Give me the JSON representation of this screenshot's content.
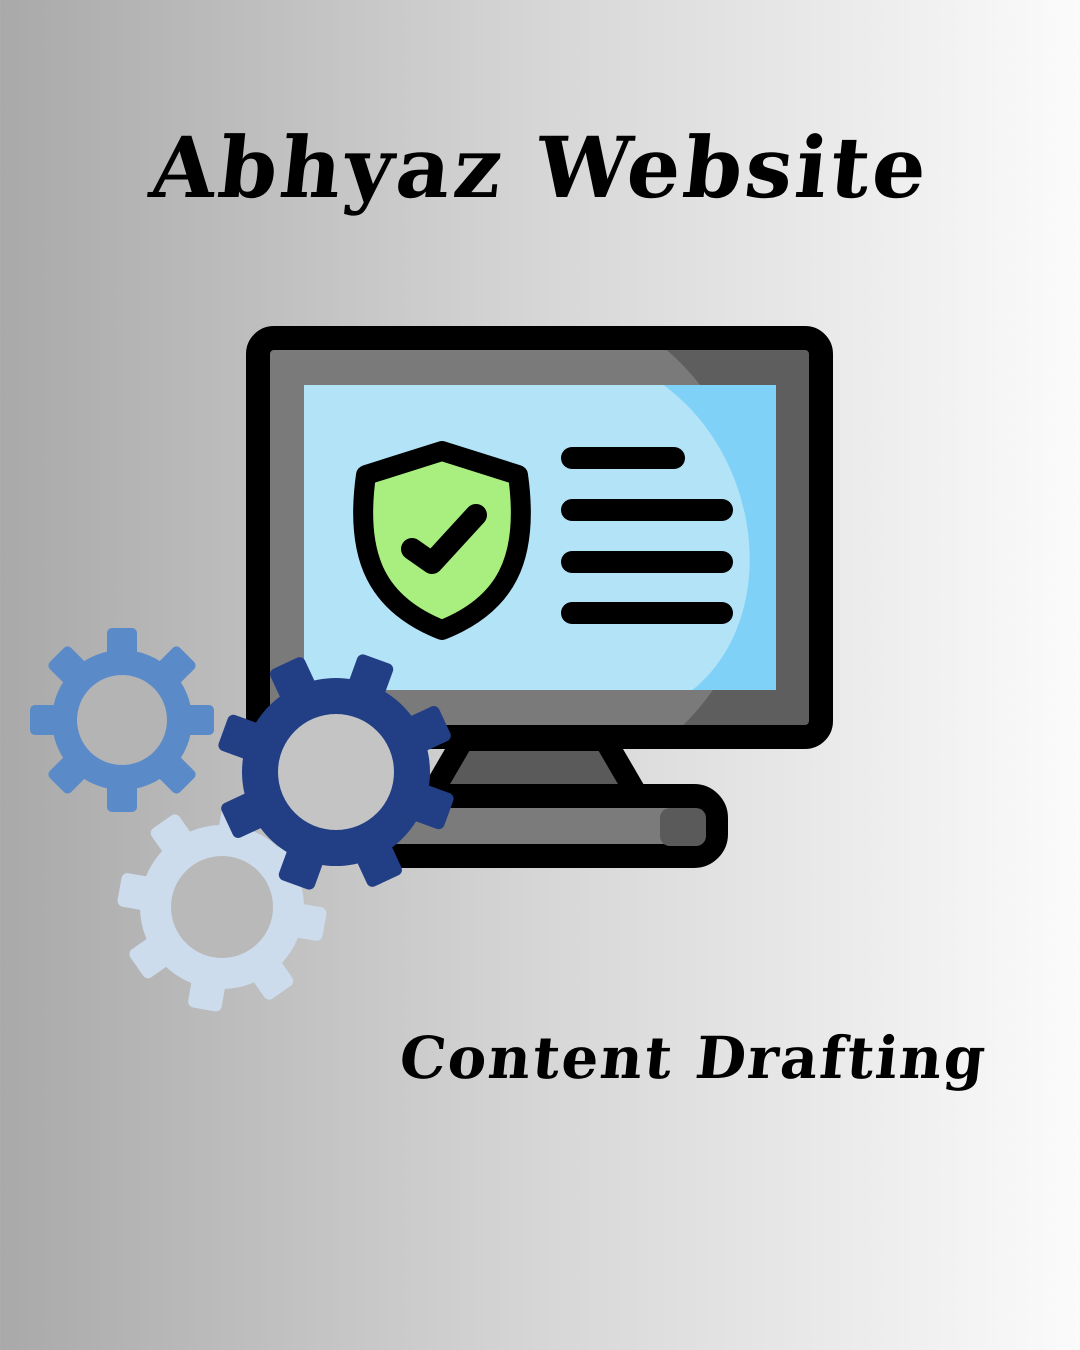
{
  "title": "Abhyaz Website",
  "subtitle": "Content Drafting",
  "icons": [
    "monitor-icon",
    "shield-check-icon",
    "gear-icon"
  ],
  "colors": {
    "background_left": "#a9a9a9",
    "background_right": "#fbfbfb",
    "screen": "#b3e3f7",
    "screen_highlight": "#80d1f8",
    "shield": "#a8ef7f",
    "gear_medium": "#5b8ac8",
    "gear_dark": "#223f86",
    "gear_light": "#cddcec"
  }
}
